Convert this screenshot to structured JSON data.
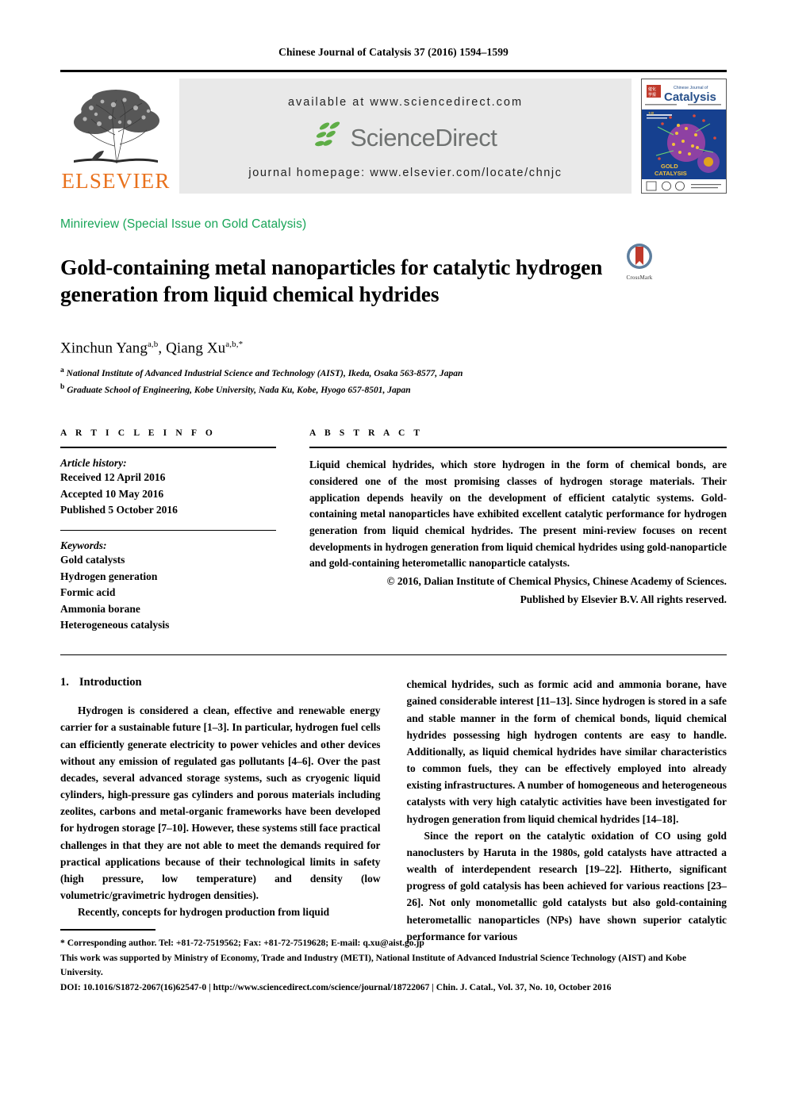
{
  "running_head": "Chinese Journal of Catalysis 37 (2016) 1594–1599",
  "masthead": {
    "publisher_name": "ELSEVIER",
    "available_at": "available at www.sciencedirect.com",
    "sciencedirect_label": "ScienceDirect",
    "journal_homepage": "journal homepage: www.elsevier.com/locate/chnjc",
    "cover_title_line1": "Chinese Journal of",
    "cover_title_line2": "Catalysis",
    "cover_banner_line1": "GOLD",
    "cover_banner_line2": "CATALYSIS"
  },
  "colors": {
    "elsevier_orange": "#E9711C",
    "sciencedirect_green": "#5EAD46",
    "sciencedirect_gray": "#6F7271",
    "doctype_green": "#18A558",
    "crossmark_red": "#C0392B",
    "crossmark_blue": "#5D7E9E",
    "band_gray": "#E9E9E9"
  },
  "article": {
    "doctype": "Minireview (Special Issue on Gold Catalysis)",
    "title": "Gold-containing metal nanoparticles for catalytic hydrogen generation from liquid chemical hydrides",
    "crossmark_label": "CrossMark",
    "authors_plain": "Xinchun Yang a,b, Qiang Xu a,b,*",
    "authors": [
      {
        "name": "Xinchun Yang",
        "marks": "a,b",
        "sep": ", "
      },
      {
        "name": "Qiang Xu",
        "marks": "a,b,*",
        "sep": ""
      }
    ],
    "affiliations": [
      {
        "mark": "a",
        "text": "National Institute of Advanced Industrial Science and Technology (AIST), Ikeda, Osaka 563-8577, Japan"
      },
      {
        "mark": "b",
        "text": "Graduate School of Engineering, Kobe University, Nada Ku, Kobe, Hyogo 657-8501, Japan"
      }
    ]
  },
  "article_info": {
    "heading": "A R T I C L E    I N F O",
    "history_label": "Article history:",
    "history": [
      "Received 12 April 2016",
      "Accepted 10 May 2016",
      "Published 5 October 2016"
    ],
    "keywords_label": "Keywords:",
    "keywords": [
      "Gold catalysts",
      "Hydrogen generation",
      "Formic acid",
      "Ammonia borane",
      "Heterogeneous catalysis"
    ]
  },
  "abstract": {
    "heading": "A B S T R A C T",
    "body": "Liquid chemical hydrides, which store hydrogen in the form of chemical bonds, are considered one of the most promising classes of hydrogen storage materials. Their application depends heavily on the development of efficient catalytic systems. Gold-containing metal nanoparticles have exhibited excellent catalytic performance for hydrogen generation from liquid chemical hydrides. The present mini-review focuses on recent developments in hydrogen generation from liquid chemical hydrides using gold-nanoparticle and gold-containing heterometallic nanoparticle catalysts.",
    "copyright_line1": "© 2016, Dalian Institute of Chemical Physics, Chinese Academy of Sciences.",
    "copyright_line2": "Published by Elsevier B.V. All rights reserved."
  },
  "body": {
    "section_number": "1.",
    "section_title": "Introduction",
    "left_paragraphs": [
      "Hydrogen is considered a clean, effective and renewable energy carrier for a sustainable future [1–3]. In particular, hydrogen fuel cells can efficiently generate electricity to power vehicles and other devices without any emission of regulated gas pollutants [4–6]. Over the past decades, several advanced storage systems, such as cryogenic liquid cylinders, high-pressure gas cylinders and porous materials including zeolites, carbons and metal-organic frameworks have been developed for hydrogen storage [7–10]. However, these systems still face practical challenges in that they are not able to meet the demands required for practical applications because of their technological limits in safety (high pressure, low temperature) and density (low volumetric/gravimetric hydrogen densities).",
      "Recently, concepts for hydrogen production from liquid"
    ],
    "right_paragraphs": [
      "chemical hydrides, such as formic acid and ammonia borane, have gained considerable interest [11–13]. Since hydrogen is stored in a safe and stable manner in the form of chemical bonds, liquid chemical hydrides possessing high hydrogen contents are easy to handle. Additionally, as liquid chemical hydrides have similar characteristics to common fuels, they can be effectively employed into already existing infrastructures. A number of homogeneous and heterogeneous catalysts with very high catalytic activities have been investigated for hydrogen generation from liquid chemical hydrides [14–18].",
      "Since the report on the catalytic oxidation of CO using gold nanoclusters by Haruta in the 1980s, gold catalysts have attracted a wealth of interdependent research [19–22]. Hitherto, significant progress of gold catalysis has been achieved for various reactions [23–26]. Not only monometallic gold catalysts but also gold-containing heterometallic nanoparticles (NPs) have shown superior catalytic performance for various"
    ]
  },
  "footnotes": {
    "corresponding": "* Corresponding author. Tel: +81-72-7519562; Fax: +81-72-7519628; E-mail: q.xu@aist.go.jp",
    "funding": "This work was supported by Ministry of Economy, Trade and Industry (METI), National Institute of Advanced Industrial Science Technology (AIST) and Kobe University.",
    "doi_line": "DOI: 10.1016/S1872-2067(16)62547-0 | http://www.sciencedirect.com/science/journal/18722067 | Chin. J. Catal., Vol. 37, No. 10, October 2016"
  }
}
